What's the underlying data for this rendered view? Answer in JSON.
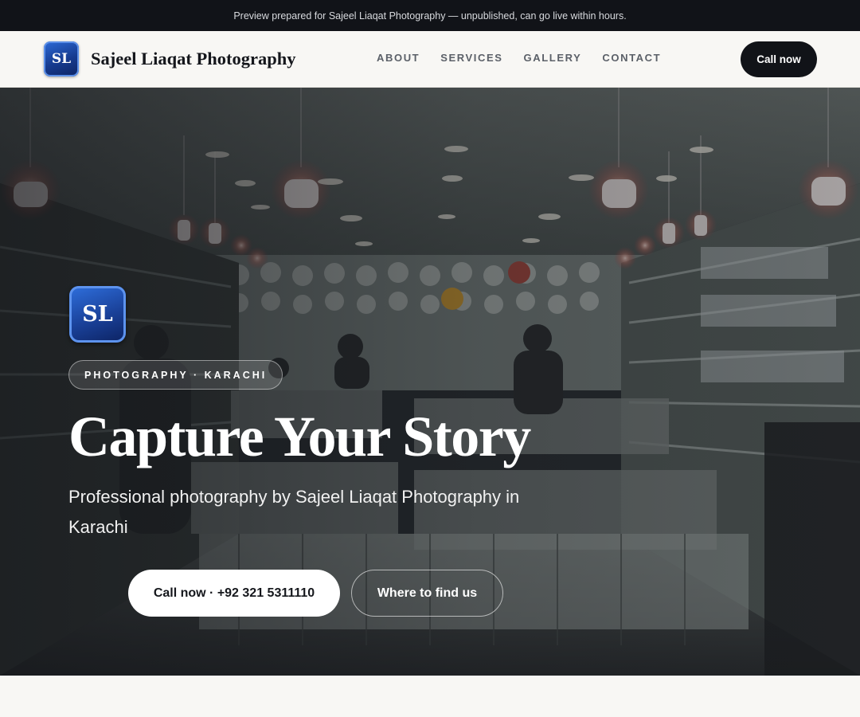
{
  "topbar": {
    "text": "Preview prepared for Sajeel Liaqat Photography — unpublished, can go live within hours."
  },
  "navbar": {
    "logo_initials": "SL",
    "brand": "Sajeel Liaqat Photography",
    "links": [
      "ABOUT",
      "SERVICES",
      "GALLERY",
      "CONTACT"
    ],
    "cta": "Call now"
  },
  "hero": {
    "logo_initials": "SL",
    "eyebrow": "PHOTOGRAPHY · KARACHI",
    "title": "Capture Your Story",
    "subtitle": "Professional photography by Sajeel Liaqat Photography in Karachi",
    "primary_button": "Call now · +92 321 5311110",
    "secondary_button": "Where to find us",
    "background": "shop-interior-photo"
  },
  "colors": {
    "dark": "#111318",
    "logo_blue": "#1a4199",
    "page_bg": "#f8f7f4"
  }
}
